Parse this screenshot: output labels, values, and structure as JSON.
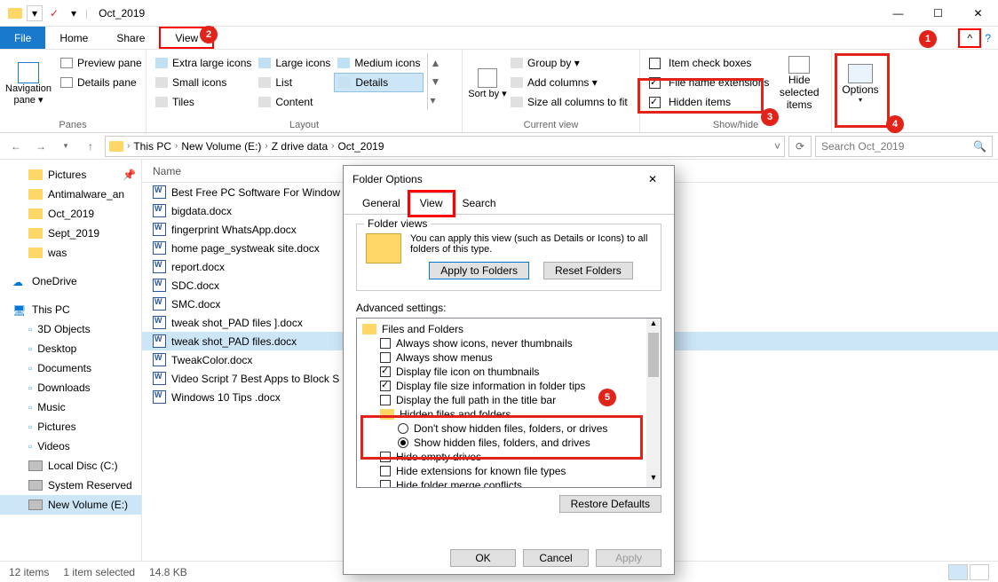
{
  "window": {
    "title": "Oct_2019"
  },
  "tabs": {
    "file": "File",
    "home": "Home",
    "share": "Share",
    "view": "View"
  },
  "ribbon": {
    "panes": {
      "label": "Panes",
      "nav": "Navigation pane ▾",
      "preview": "Preview pane",
      "details": "Details pane"
    },
    "layout": {
      "label": "Layout",
      "xl": "Extra large icons",
      "lg": "Large icons",
      "md": "Medium icons",
      "sm": "Small icons",
      "list": "List",
      "details": "Details",
      "tiles": "Tiles",
      "content": "Content"
    },
    "current": {
      "label": "Current view",
      "sort": "Sort by ▾",
      "group": "Group by ▾",
      "addcols": "Add columns ▾",
      "sizecols": "Size all columns to fit"
    },
    "showhide": {
      "label": "Show/hide",
      "checkboxes": "Item check boxes",
      "extensions": "File name extensions",
      "hidden": "Hidden items",
      "hidesel": "Hide selected items"
    },
    "options": "Options"
  },
  "breadcrumb": {
    "segments": [
      "This PC",
      "New Volume (E:)",
      "Z drive data",
      "Oct_2019"
    ]
  },
  "search": {
    "placeholder": "Search Oct_2019"
  },
  "sidebar": {
    "pictures_qa": "Pictures",
    "items": [
      "Antimalware_an",
      "Oct_2019",
      "Sept_2019",
      "was"
    ],
    "onedrive": "OneDrive",
    "thispc": "This PC",
    "folders": [
      "3D Objects",
      "Desktop",
      "Documents",
      "Downloads",
      "Music",
      "Pictures",
      "Videos",
      "Local Disc (C:)",
      "System Reserved",
      "New Volume (E:)"
    ]
  },
  "filelist": {
    "header_name": "Name",
    "files": [
      "Best Free PC Software For Window",
      "bigdata.docx",
      "fingerprint WhatsApp.docx",
      "home page_systweak site.docx",
      "report.docx",
      "SDC.docx",
      "SMC.docx",
      "tweak shot_PAD files ].docx",
      "tweak shot_PAD files.docx",
      "TweakColor.docx",
      "Video Script 7 Best Apps to Block S",
      "Windows 10 Tips .docx"
    ],
    "selected_index": 8
  },
  "status": {
    "items": "12 items",
    "sel": "1 item selected",
    "size": "14.8 KB"
  },
  "dialog": {
    "title": "Folder Options",
    "tabs": {
      "general": "General",
      "view": "View",
      "search": "Search"
    },
    "fv": {
      "legend": "Folder views",
      "text": "You can apply this view (such as Details or Icons) to all folders of this type.",
      "apply": "Apply to Folders",
      "reset": "Reset Folders"
    },
    "adv": {
      "label": "Advanced settings:",
      "root": "Files and Folders",
      "rows": [
        {
          "txt": "Always show icons, never thumbnails",
          "chk": false
        },
        {
          "txt": "Always show menus",
          "chk": false
        },
        {
          "txt": "Display file icon on thumbnails",
          "chk": true
        },
        {
          "txt": "Display file size information in folder tips",
          "chk": true
        },
        {
          "txt": "Display the full path in the title bar",
          "chk": false
        }
      ],
      "hidden_hdr": "Hidden files and folders",
      "hidden_opts": [
        {
          "txt": "Don't show hidden files, folders, or drives",
          "on": false
        },
        {
          "txt": "Show hidden files, folders, and drives",
          "on": true
        }
      ],
      "after": [
        {
          "txt": "Hide empty drives",
          "chk": false
        },
        {
          "txt": "Hide extensions for known file types",
          "chk": false
        },
        {
          "txt": "Hide folder merge conflicts",
          "chk": false
        }
      ],
      "restore": "Restore Defaults"
    },
    "ok": "OK",
    "cancel": "Cancel",
    "apply": "Apply"
  },
  "annotations": [
    "1",
    "2",
    "3",
    "4",
    "5"
  ]
}
